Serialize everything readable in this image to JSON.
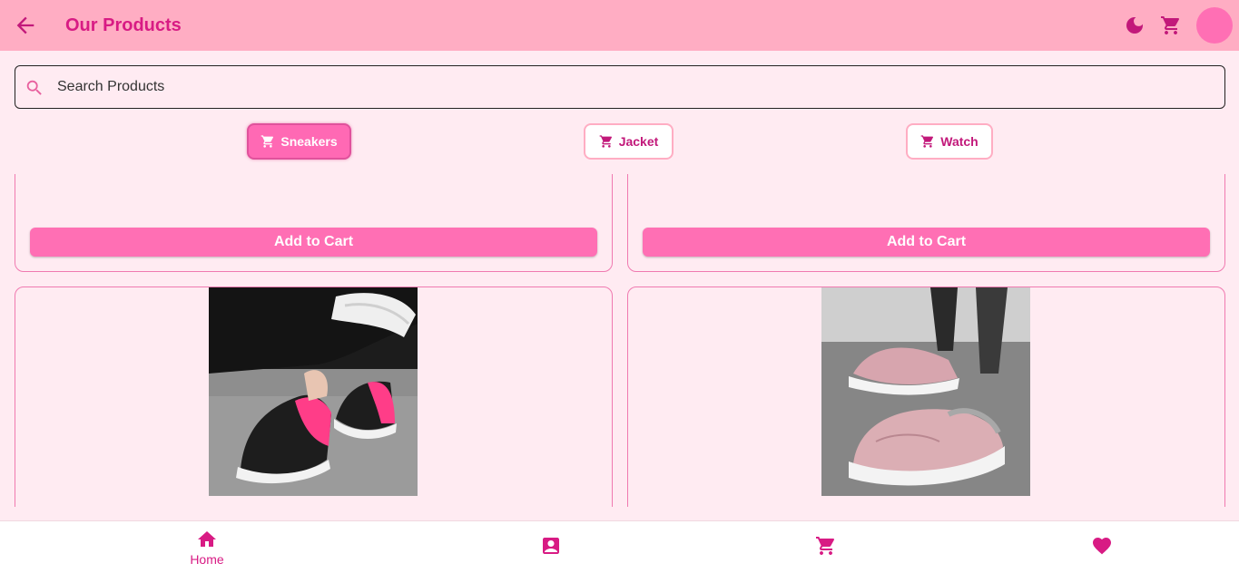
{
  "appbar": {
    "title": "Our Products",
    "icons": [
      "back-arrow-icon",
      "moon-icon",
      "cart-icon",
      "avatar"
    ],
    "accent": "#d81b84",
    "background": "#ffadc3"
  },
  "search": {
    "placeholder": "Search Products"
  },
  "categories": [
    {
      "label": "Sneakers",
      "active": true
    },
    {
      "label": "Jacket",
      "active": false
    },
    {
      "label": "Watch",
      "active": false
    }
  ],
  "products": {
    "add_to_cart_label": "Add to Cart"
  },
  "bottom_nav": {
    "items": [
      {
        "label": "Home",
        "icon": "home-icon",
        "active": true
      },
      {
        "label": "",
        "icon": "contact-icon",
        "active": false
      },
      {
        "label": "",
        "icon": "cart-icon",
        "active": false
      },
      {
        "label": "",
        "icon": "heart-icon",
        "active": false
      }
    ]
  },
  "colors": {
    "button": "#ff6fb4",
    "card_border": "#f07ab0",
    "page_bg": "#ffebf2"
  }
}
